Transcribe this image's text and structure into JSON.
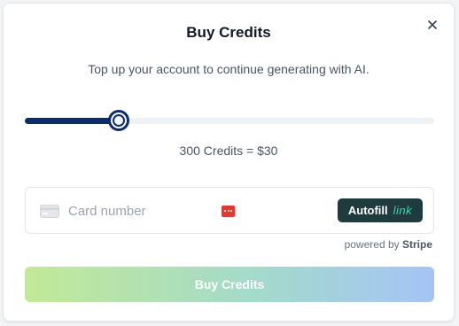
{
  "modal": {
    "title": "Buy Credits",
    "subtitle": "Top up your account to continue generating with AI.",
    "close_icon": "close-icon"
  },
  "slider": {
    "value_fraction": 0.23,
    "fill_color": "#0b2d6b",
    "track_color": "#eef2f7"
  },
  "credits": {
    "label": "300 Credits = $30"
  },
  "card": {
    "placeholder": "Card number",
    "value": "",
    "card_icon": "credit-card-icon",
    "brand_icon": "card-brand-icon",
    "autofill_label": "Autofill",
    "autofill_brand": "link"
  },
  "powered_by": {
    "prefix": "powered by",
    "brand": "Stripe"
  },
  "buy_button": {
    "label": "Buy Credits"
  },
  "colors": {
    "autofill_bg": "#1f3b3e",
    "autofill_link": "#33ddb3",
    "buy_gradient_start": "#bde78e",
    "buy_gradient_end": "#9dbff5"
  }
}
